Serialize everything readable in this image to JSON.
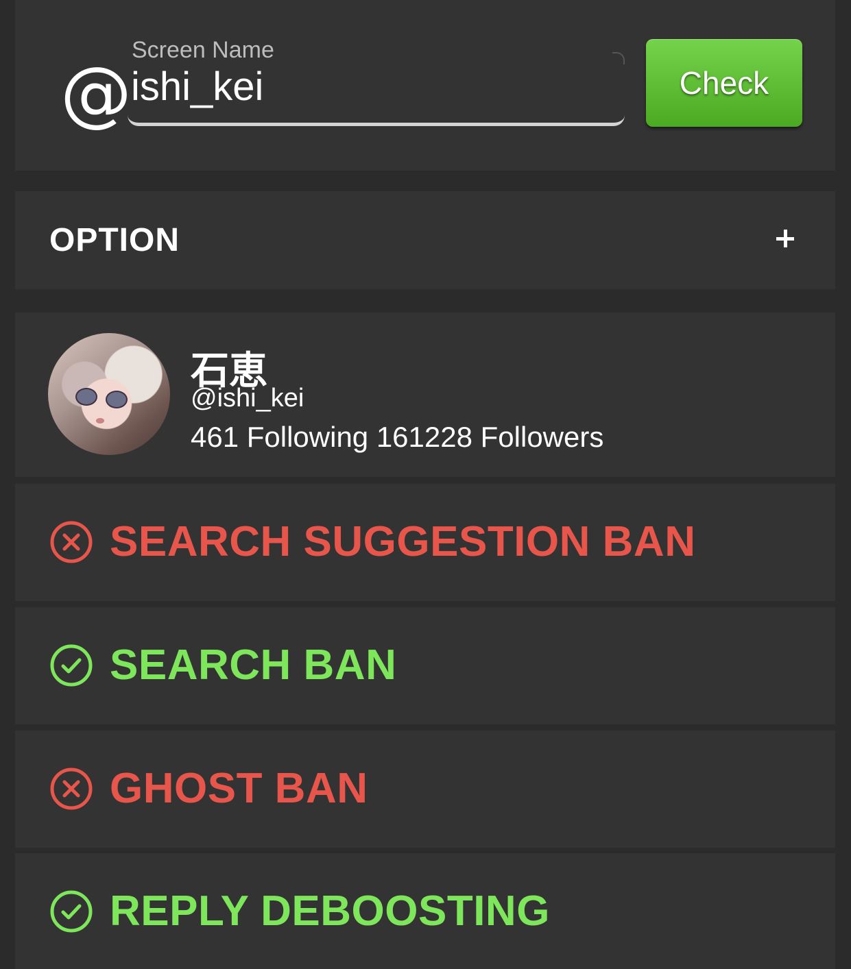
{
  "search": {
    "label": "Screen Name",
    "value": "ishi_kei",
    "at_symbol": "@",
    "check_label": "Check"
  },
  "option": {
    "title": "OPTION",
    "toggle_icon": "plus-icon"
  },
  "profile": {
    "display_name": "石恵",
    "handle": "@ishi_kei",
    "stats": "461 Following 161228 Followers"
  },
  "results": [
    {
      "label": "SEARCH SUGGESTION BAN",
      "status": "banned",
      "icon": "x-circle-icon",
      "color": "#e8554b"
    },
    {
      "label": "SEARCH BAN",
      "status": "ok",
      "icon": "check-circle-icon",
      "color": "#7ee65a"
    },
    {
      "label": "GHOST BAN",
      "status": "banned",
      "icon": "x-circle-icon",
      "color": "#e8554b"
    },
    {
      "label": "REPLY DEBOOSTING",
      "status": "ok",
      "icon": "check-circle-icon",
      "color": "#7ee65a"
    }
  ],
  "colors": {
    "background": "#2b2b2b",
    "card": "#333333",
    "button": "#5cbf2f",
    "fail": "#e8554b",
    "pass": "#7ee65a"
  }
}
